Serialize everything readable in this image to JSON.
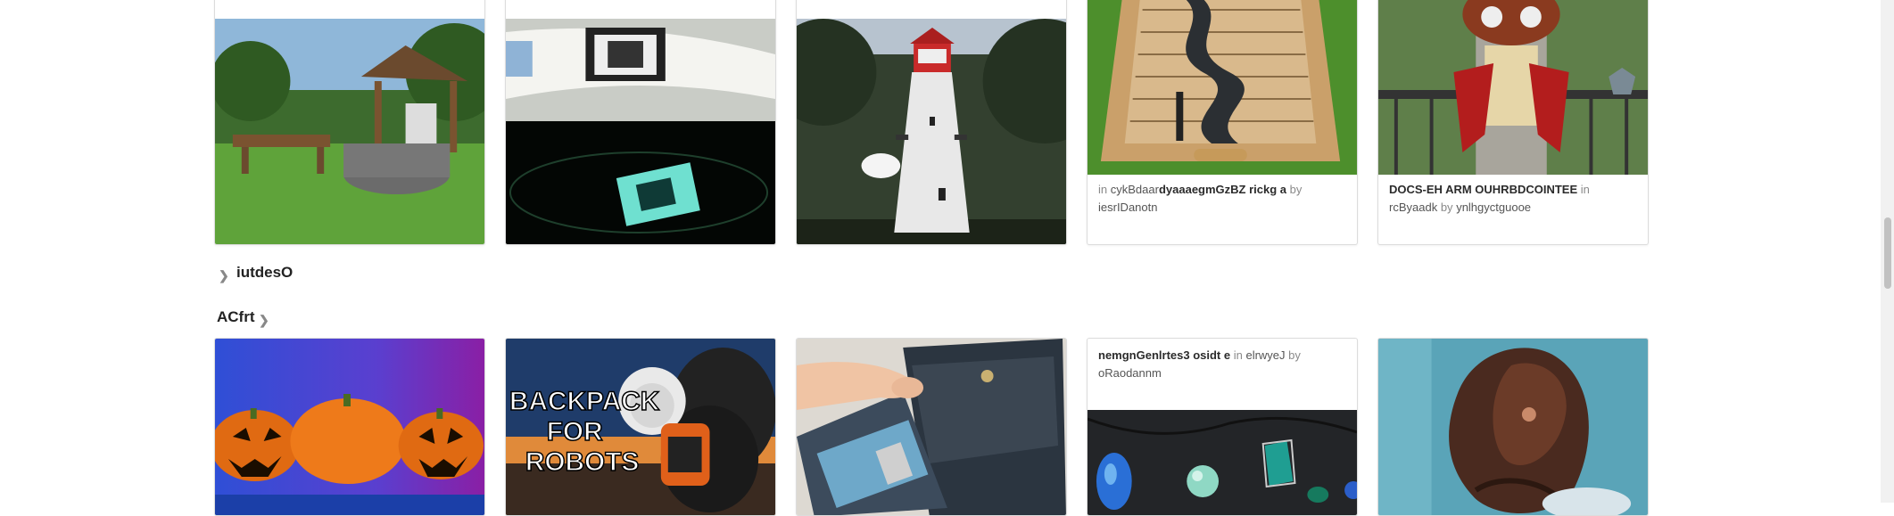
{
  "row1": {
    "cards": [
      {
        "image": "wooden-gazebo-garden-well"
      },
      {
        "image": "surfboard-glow-print"
      },
      {
        "image": "lighthouse-birdhouse"
      },
      {
        "image": "wooden-shuffle-score-board",
        "prefix": "in",
        "category": "cykBdaar",
        "title": "dyaaaegmGzBZ rickg a",
        "by": "by",
        "author": "iesrIDanotn"
      },
      {
        "image": "wooden-owl-clock",
        "title": "DOCS-EH ARM OUHRBDCOINTEE",
        "prefix": "in",
        "category": "rcByaadk",
        "by": "by",
        "author": "ynlhgyctguooe"
      }
    ]
  },
  "section_outside": {
    "title": "iutdesO",
    "icon": "chevron-right-icon"
  },
  "section_craft": {
    "title": "ACfrt",
    "icon": "chevron-right-icon"
  },
  "row2": {
    "cards": [
      {
        "image": "halloween-pumpkins"
      },
      {
        "image": "backpack-for-robots",
        "overlay_text": [
          "BACKPACK",
          "FOR",
          "ROBOTS"
        ]
      },
      {
        "image": "leather-wallet"
      },
      {
        "image": "gemstone-pendants",
        "title": "nemgnGenlrtes3 osidt e",
        "prefix": "in",
        "category": "elrwyeJ",
        "by": "by",
        "author": "oRaodannm"
      },
      {
        "image": "bronze-dragon-head"
      }
    ]
  },
  "colors": {
    "accent": "#2b2b2b",
    "muted": "#8a8a8a",
    "border": "#dcdcdc"
  }
}
